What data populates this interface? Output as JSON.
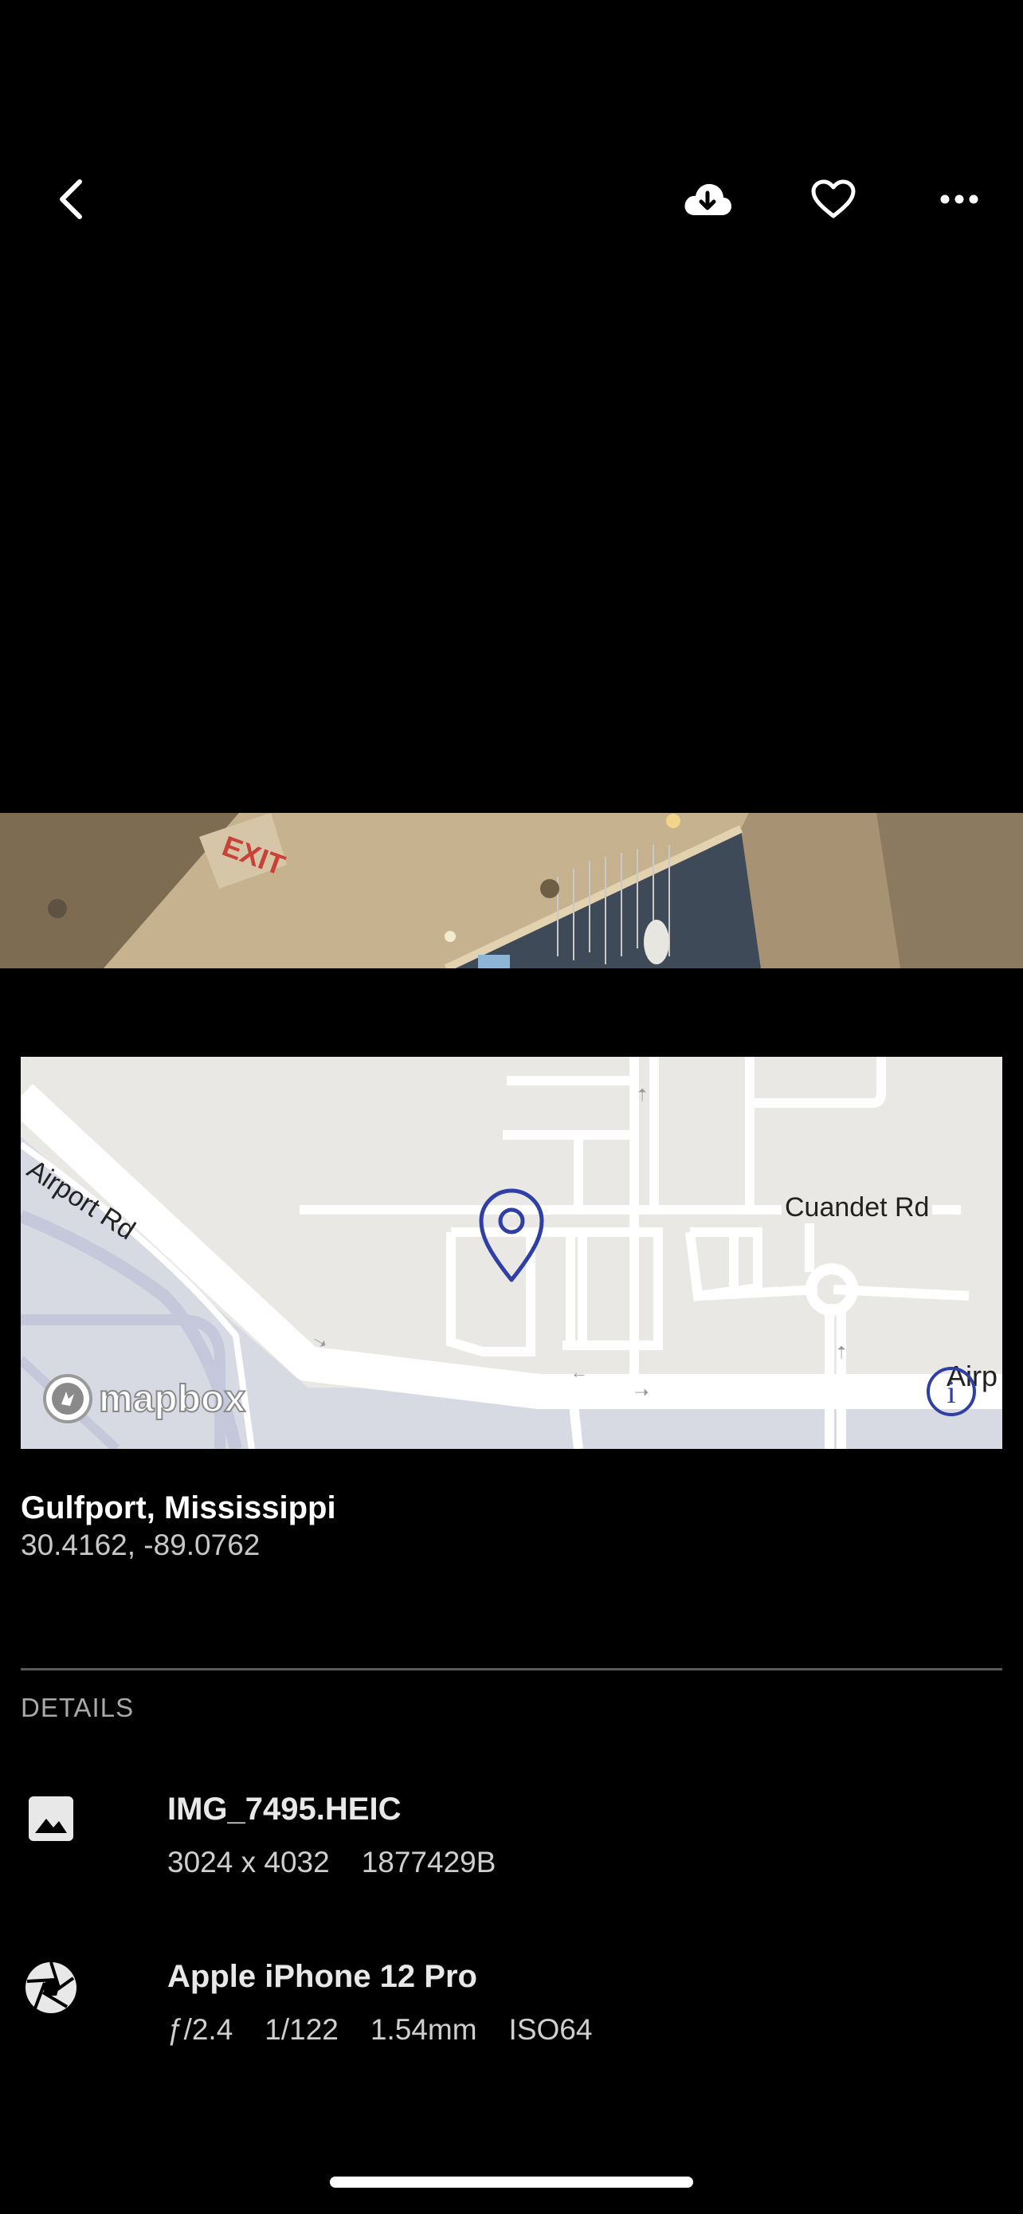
{
  "toolbar": {
    "back_icon": "chevron-left-icon",
    "download_icon": "cloud-download-icon",
    "favorite_icon": "heart-icon",
    "more_icon": "more-horizontal-icon"
  },
  "map": {
    "labels": {
      "airport_rd": "Airport Rd",
      "cuandet_rd": "Cuandet Rd",
      "airp": "Airp"
    },
    "attribution_logo": "mapbox",
    "pin_color": "#2f3fa6"
  },
  "location": {
    "name": "Gulfport, Mississippi",
    "coordinates": "30.4162, -89.0762"
  },
  "details": {
    "header": "DETAILS",
    "file": {
      "icon": "image-icon",
      "name": "IMG_7495.HEIC",
      "dimensions": "3024 x 4032",
      "size": "1877429B"
    },
    "camera": {
      "icon": "aperture-icon",
      "model": "Apple iPhone 12 Pro",
      "aperture": "ƒ/2.4",
      "shutter": "1/122",
      "focal_length": "1.54mm",
      "iso": "ISO64"
    }
  }
}
